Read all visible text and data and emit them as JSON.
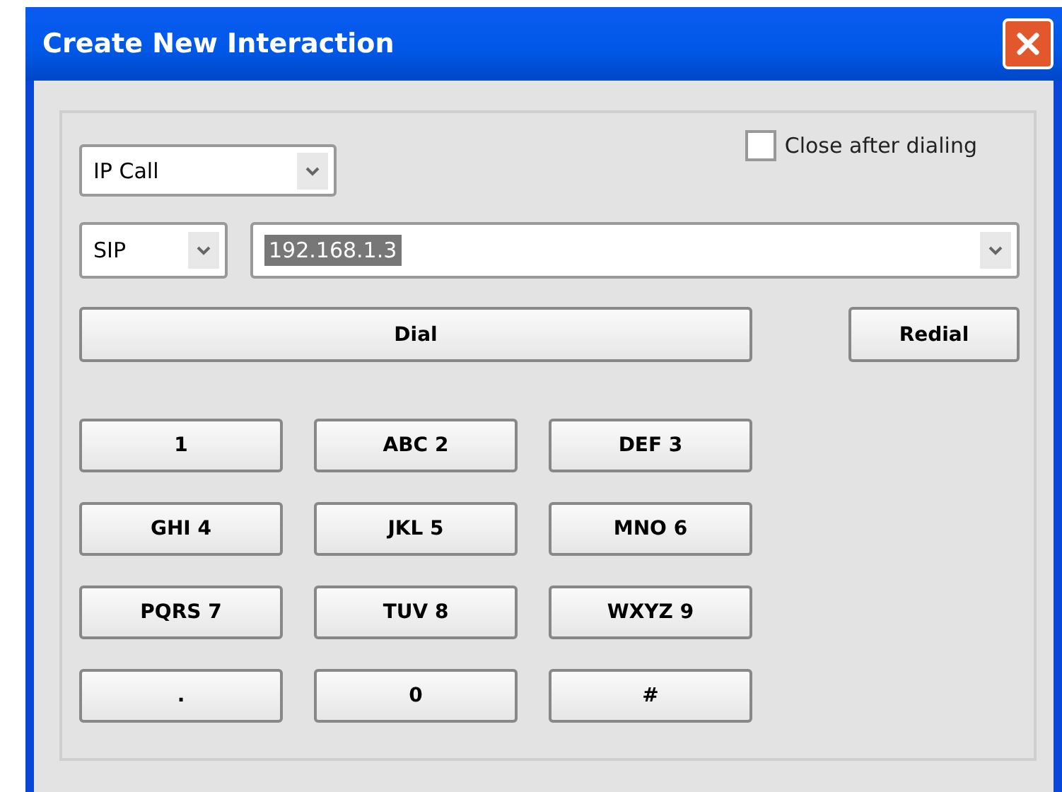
{
  "window": {
    "title": "Create New Interaction"
  },
  "interaction_type": {
    "value": "IP Call"
  },
  "close_after_dialing": {
    "label": "Close after dialing",
    "checked": false
  },
  "protocol": {
    "value": "SIP"
  },
  "address": {
    "value": "192.168.1.3",
    "selected": true
  },
  "buttons": [
    {
      "label": "Dial"
    },
    {
      "label": "Redial"
    }
  ],
  "keypad": [
    {
      "label": "1"
    },
    {
      "label": "ABC 2"
    },
    {
      "label": "DEF 3"
    },
    {
      "label": "GHI 4"
    },
    {
      "label": "JKL 5"
    },
    {
      "label": "MNO 6"
    },
    {
      "label": "PQRS 7"
    },
    {
      "label": "TUV 8"
    },
    {
      "label": "WXYZ 9"
    },
    {
      "label": "."
    },
    {
      "label": "0"
    },
    {
      "label": "#"
    }
  ]
}
